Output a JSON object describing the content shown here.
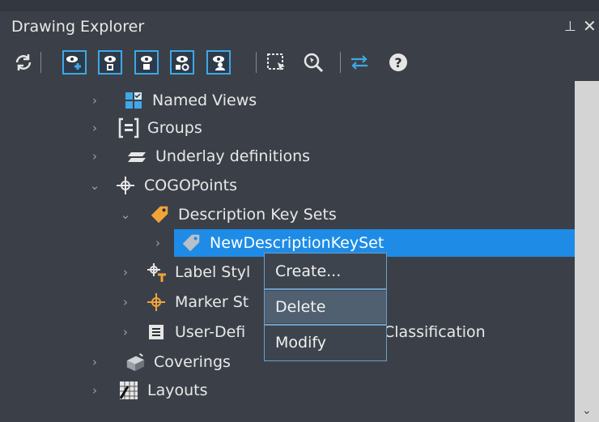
{
  "panel": {
    "title": "Drawing Explorer",
    "pin_glyph": "⊥",
    "close_glyph": "✕"
  },
  "toolbar": {
    "buttons": [
      {
        "name": "refresh-icon"
      },
      {
        "name": "view-add-icon"
      },
      {
        "name": "view-small-icon"
      },
      {
        "name": "view-medium-icon"
      },
      {
        "name": "view-refresh-icon"
      },
      {
        "name": "view-user-icon"
      },
      {
        "name": "select-icon"
      },
      {
        "name": "zoom-to-icon"
      },
      {
        "name": "sync-icon"
      },
      {
        "name": "help-icon"
      }
    ],
    "accent": "#3fa8e6"
  },
  "tree": {
    "items": [
      {
        "label": "Named Views",
        "icon": "named-views-icon"
      },
      {
        "label": "Groups",
        "icon": "groups-icon"
      },
      {
        "label": "Underlay definitions",
        "icon": "underlay-icon"
      },
      {
        "label": "COGOPoints",
        "icon": "cogo-point-icon"
      },
      {
        "label": "Description Key Sets",
        "icon": "tag-icon"
      },
      {
        "label": "NewDescriptionKeySet",
        "icon": "tag-gray-icon"
      },
      {
        "label": "Label Styl",
        "icon": "label-style-icon"
      },
      {
        "label": "Marker St",
        "icon": "marker-style-icon"
      },
      {
        "label": "User-Defi",
        "icon": "user-defined-icon"
      },
      {
        "label": "Classification",
        "icon": ""
      },
      {
        "label": "Coverings",
        "icon": "coverings-icon"
      },
      {
        "label": "Layouts",
        "icon": "layouts-icon"
      }
    ],
    "selection_color": "#1e8ce6"
  },
  "context_menu": {
    "items": [
      {
        "label": "Create..."
      },
      {
        "label": "Delete"
      },
      {
        "label": "Modify"
      }
    ]
  }
}
